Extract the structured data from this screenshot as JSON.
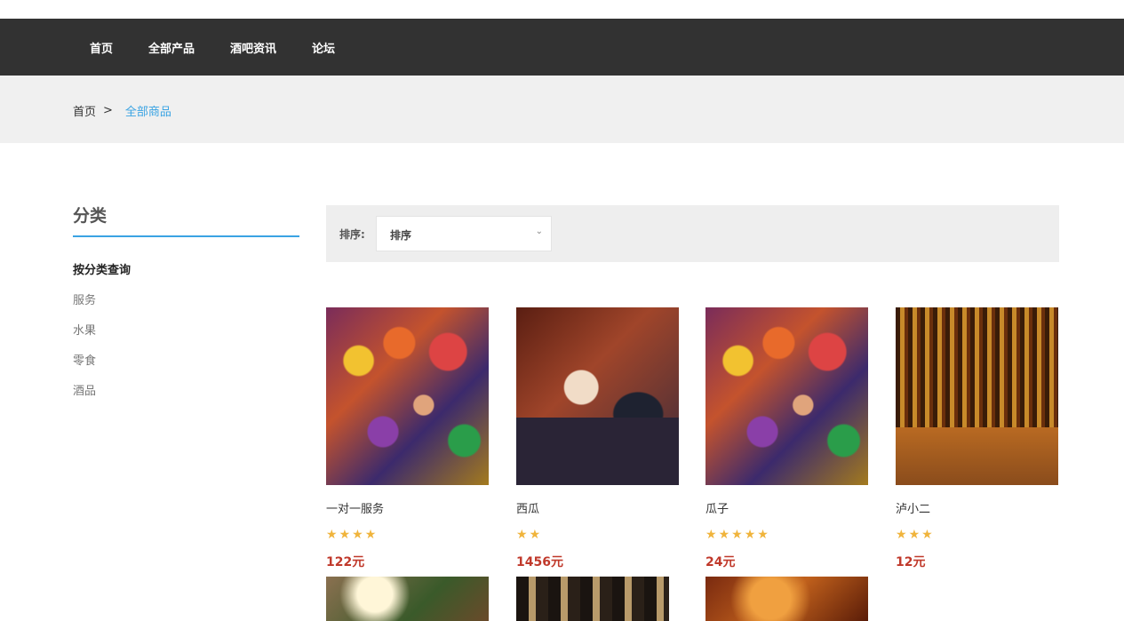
{
  "nav": {
    "items": [
      "首页",
      "全部产品",
      "酒吧资讯",
      "论坛"
    ]
  },
  "breadcrumb": {
    "home": "首页",
    "separator": ">",
    "current": "全部商品"
  },
  "sidebar": {
    "title": "分类",
    "section_heading": "按分类查询",
    "categories": [
      "服务",
      "水果",
      "零食",
      "酒品"
    ]
  },
  "sort": {
    "label": "排序:",
    "selected": "排序"
  },
  "products": [
    {
      "name": "一对一服务",
      "rating": 4,
      "price": "122元"
    },
    {
      "name": "西瓜",
      "rating": 2,
      "price": "1456元"
    },
    {
      "name": "瓜子",
      "rating": 5,
      "price": "24元"
    },
    {
      "name": "泸小二",
      "rating": 3,
      "price": "12元"
    }
  ],
  "colors": {
    "accent": "#3aa3e3",
    "price": "#c0392b",
    "star": "#f0b43c",
    "topbar": "#323232"
  }
}
